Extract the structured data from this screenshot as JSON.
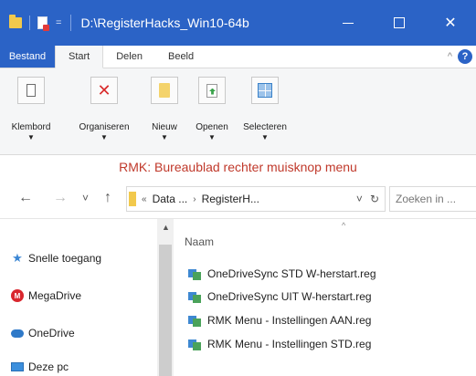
{
  "window": {
    "title": "D:\\RegisterHacks_Win10-64b",
    "controls": {
      "minimize": "",
      "maximize": "",
      "close": "✕"
    },
    "quick_access_drop": "="
  },
  "ribbon_tabs": {
    "file": "Bestand",
    "tabs": [
      "Start",
      "Delen",
      "Beeld"
    ],
    "chevron": "^",
    "help": "?"
  },
  "ribbon_groups": [
    {
      "label": "Klembord",
      "icon": "clipboard-icon"
    },
    {
      "label": "Organiseren",
      "icon": "delete-x-icon"
    },
    {
      "label": "Nieuw",
      "icon": "new-folder-icon"
    },
    {
      "label": "Openen",
      "icon": "open-icon"
    },
    {
      "label": "Selecteren",
      "icon": "select-icon"
    }
  ],
  "ribbon_drop_glyph": "▼",
  "banner": {
    "text": "RMK: Bureaublad rechter muisknop menu",
    "color": "#c0392b"
  },
  "address_bar": {
    "back": "←",
    "forward": "→",
    "recent": "˅",
    "up": "↑",
    "sep1": "«",
    "segment1": "Data ...",
    "sep2": "›",
    "segment2": "RegisterH...",
    "dropdown": "˅",
    "refresh": "↻",
    "search_placeholder": "Zoeken in ..."
  },
  "nav_pane": {
    "items": [
      {
        "label": "Snelle toegang",
        "icon": "star-icon"
      },
      {
        "label": "MegaDrive",
        "icon": "megadrive-icon"
      },
      {
        "label": "OneDrive",
        "icon": "onedrive-icon"
      },
      {
        "label": "Deze pc",
        "icon": "pc-icon"
      }
    ]
  },
  "file_list": {
    "column_header": "Naam",
    "sort_caret": "^",
    "files": [
      "OneDriveSync STD W-herstart.reg",
      "OneDriveSync UIT W-herstart.reg",
      "RMK Menu - Instellingen AAN.reg",
      "RMK Menu - Instellingen STD.reg"
    ]
  },
  "colors": {
    "accent": "#2b63c6",
    "ribbon_bg": "#f5f6f7",
    "delete": "#d92c2c"
  }
}
